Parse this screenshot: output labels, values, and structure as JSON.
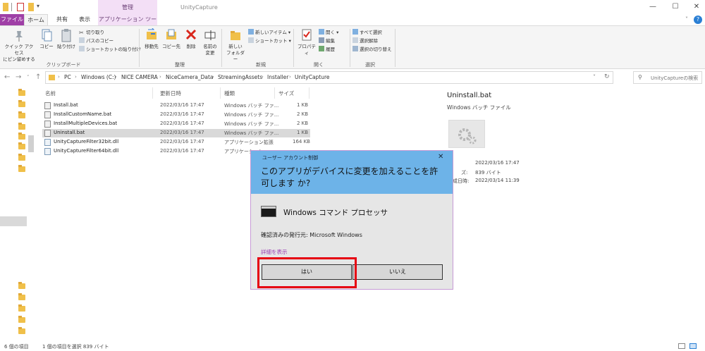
{
  "window": {
    "title": "UnityCapture",
    "context_tab_header": "管理"
  },
  "ribbon_tabs": {
    "file": "ファイル",
    "home": "ホーム",
    "share": "共有",
    "view": "表示",
    "app_tools": "アプリケーション ツール"
  },
  "ribbon": {
    "quick_access": "クイック アクセス\nにピン留めする",
    "copy": "コピー",
    "paste": "貼り付け",
    "cut": "切り取り",
    "copy_path": "パスのコピー",
    "paste_shortcut": "ショートカットの貼り付け",
    "clipboard_label": "クリップボード",
    "move_to": "移動先",
    "copy_to": "コピー先",
    "delete": "削除",
    "rename": "名前の\n変更",
    "organize_label": "整理",
    "new_folder": "新しい\nフォルダー",
    "new_item": "新しいアイテム",
    "shortcut": "ショートカット",
    "new_label": "新規",
    "properties": "プロパティ",
    "open": "開く",
    "edit": "編集",
    "history": "履歴",
    "open_label": "開く",
    "select_all": "すべて選択",
    "select_none": "選択解除",
    "invert_selection": "選択の切り替え",
    "select_label": "選択"
  },
  "address": {
    "crumbs": [
      "PC",
      "Windows (C:)",
      "NICE CAMERA",
      "NiceCamera_Data",
      "StreamingAssets",
      "Installer",
      "UnityCapture"
    ],
    "search_placeholder": "UnityCaptureの検索"
  },
  "filelist": {
    "headers": {
      "name": "名前",
      "date": "更新日時",
      "type": "種類",
      "size": "サイズ"
    },
    "rows": [
      {
        "name": "Install.bat",
        "date": "2022/03/16 17:47",
        "type": "Windows バッチ ファ...",
        "size": "1 KB"
      },
      {
        "name": "InstallCustomName.bat",
        "date": "2022/03/16 17:47",
        "type": "Windows バッチ ファ...",
        "size": "2 KB"
      },
      {
        "name": "InstallMultipleDevices.bat",
        "date": "2022/03/16 17:47",
        "type": "Windows バッチ ファ...",
        "size": "2 KB"
      },
      {
        "name": "Uninstall.bat",
        "date": "2022/03/16 17:47",
        "type": "Windows バッチ ファ...",
        "size": "1 KB"
      },
      {
        "name": "UnityCaptureFilter32bit.dll",
        "date": "2022/03/16 17:47",
        "type": "アプリケーション拡張",
        "size": "164 KB"
      },
      {
        "name": "UnityCaptureFilter64bit.dll",
        "date": "2022/03/16 17:47",
        "type": "アプリケーション",
        "size": ""
      }
    ]
  },
  "preview": {
    "name": "Uninstall.bat",
    "type": "Windows バッチ ファイル",
    "meta1": "2022/03/16 17:47",
    "meta2_label": "ズ:",
    "meta2": "839 バイト",
    "meta3_label": "成日時:",
    "meta3": "2022/03/14 11:39"
  },
  "status": {
    "count": "6 個の項目",
    "selection": "1 個の項目を選択  839 バイト"
  },
  "uac": {
    "title": "ユーザー アカウント制御",
    "close": "✕",
    "question": "このアプリがデバイスに変更を加えることを許可します か?",
    "app_name": "Windows コマンド プロセッサ",
    "publisher": "確認済みの発行元: Microsoft Windows",
    "details": "詳細を表示",
    "yes": "はい",
    "no": "いいえ",
    "highlight_color": "#e60012"
  }
}
